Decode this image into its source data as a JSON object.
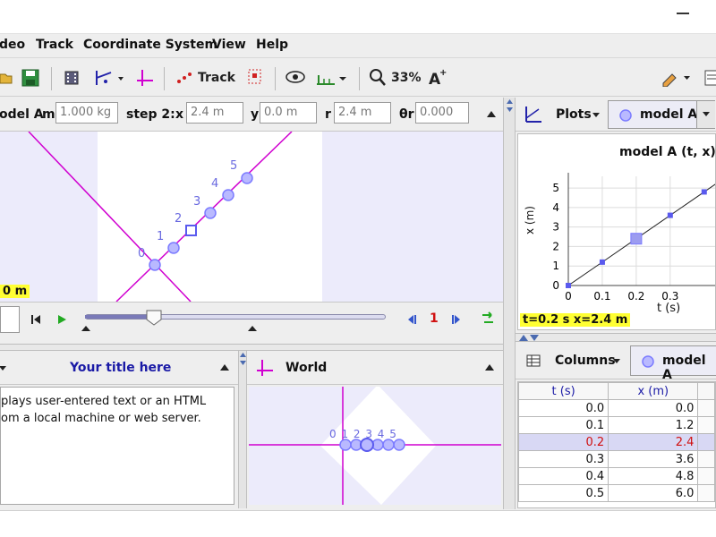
{
  "menu": [
    "deo",
    "Track",
    "Coordinate System",
    "View",
    "Help"
  ],
  "toolbar": {
    "track_label": "Track",
    "zoom_label": "33%"
  },
  "track_panel": {
    "model_label": "odel A",
    "m_label": "m",
    "m_value": "1.000 kg",
    "step_label": "step 2:",
    "x_label": "x",
    "x_value": "2.4 m",
    "y_label": "y",
    "y_value": "0.0 m",
    "r_label": "r",
    "r_value": "2.4 m",
    "theta_label": "θr",
    "theta_value": "0.000",
    "step_numbers": [
      "0",
      "1",
      "2",
      "3",
      "4",
      "5"
    ],
    "length_readout": "0 m"
  },
  "player": {
    "step_display": "1"
  },
  "text_panel": {
    "title": "Your title here",
    "line1": "plays user-entered text or an HTML",
    "line2": "om a local machine or web server."
  },
  "world_panel": {
    "title": "World",
    "labels": "0 1 2 3 4 5"
  },
  "plot_panel": {
    "plots_label": "Plots",
    "track_label": "model A",
    "title": "model A (t, x)",
    "ylabel": "x (m)",
    "xlabel": "t (s)",
    "readout": "t=0.2 s  x=2.4 m"
  },
  "chart_data": {
    "type": "line",
    "title": "model A (t, x)",
    "xlabel": "t (s)",
    "ylabel": "x (m)",
    "x": [
      0.0,
      0.1,
      0.2,
      0.3,
      0.4,
      0.5
    ],
    "y": [
      0.0,
      1.2,
      2.4,
      3.6,
      4.8,
      6.0
    ],
    "x_ticks": [
      "0",
      "0.1",
      "0.2",
      "0.3"
    ],
    "y_ticks": [
      "0",
      "1",
      "2",
      "3",
      "4",
      "5"
    ],
    "xlim": [
      0,
      0.38
    ],
    "ylim": [
      0,
      5.6
    ],
    "highlight_index": 2,
    "grid": true
  },
  "table_panel": {
    "columns_label": "Columns",
    "track_label": "model A",
    "headers": [
      "t (s)",
      "x (m)"
    ],
    "rows": [
      [
        "0.0",
        "0.0"
      ],
      [
        "0.1",
        "1.2"
      ],
      [
        "0.2",
        "2.4"
      ],
      [
        "0.3",
        "3.6"
      ],
      [
        "0.4",
        "4.8"
      ],
      [
        "0.5",
        "6.0"
      ]
    ],
    "selected_row": 2
  },
  "colors": {
    "track": "#7b7bff",
    "axes": "#d000d0",
    "readout_bg": "#ffff33",
    "title_blue": "#1a1aa6"
  }
}
